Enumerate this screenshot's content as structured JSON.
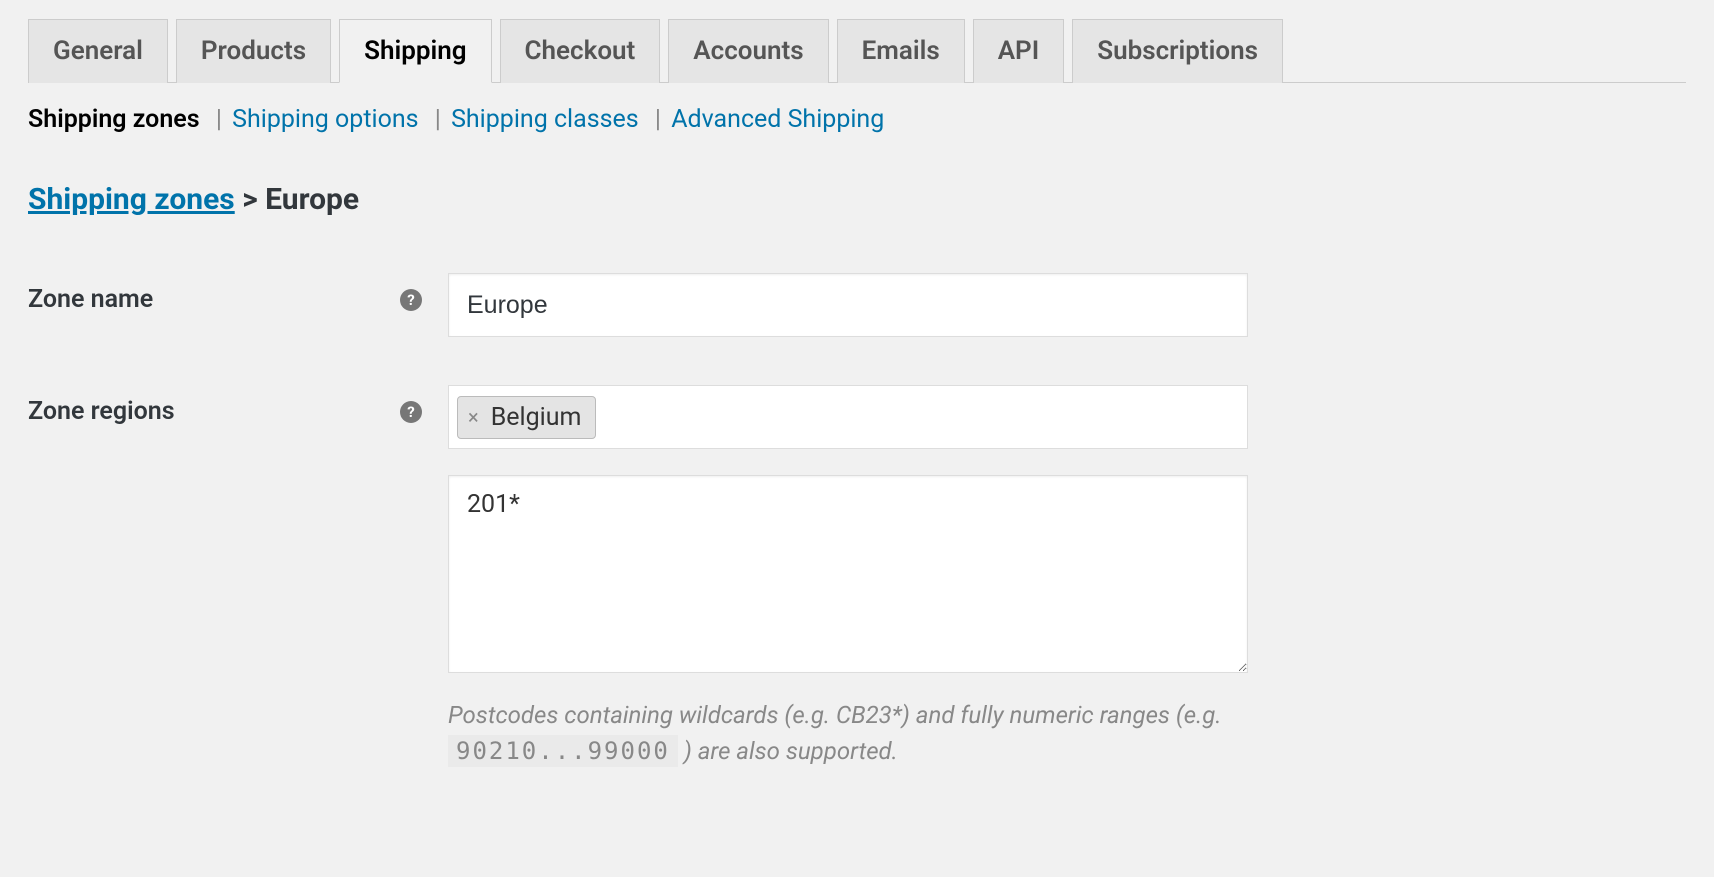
{
  "tabs": {
    "general": "General",
    "products": "Products",
    "shipping": "Shipping",
    "checkout": "Checkout",
    "accounts": "Accounts",
    "emails": "Emails",
    "api": "API",
    "subscriptions": "Subscriptions"
  },
  "subsub": {
    "zones": "Shipping zones",
    "options": "Shipping options",
    "classes": "Shipping classes",
    "advanced": "Advanced Shipping"
  },
  "breadcrumb": {
    "parent": "Shipping zones",
    "sep": ">",
    "current": "Europe"
  },
  "form": {
    "zone_name_label": "Zone name",
    "zone_name_value": "Europe",
    "zone_regions_label": "Zone regions",
    "regions": {
      "item0": "Belgium"
    },
    "postcodes_value": "201*",
    "hint_prefix": "Postcodes containing wildcards (e.g. CB23*) and fully numeric ranges (e.g. ",
    "hint_code": "90210...99000",
    "hint_suffix": " ) are also supported."
  }
}
